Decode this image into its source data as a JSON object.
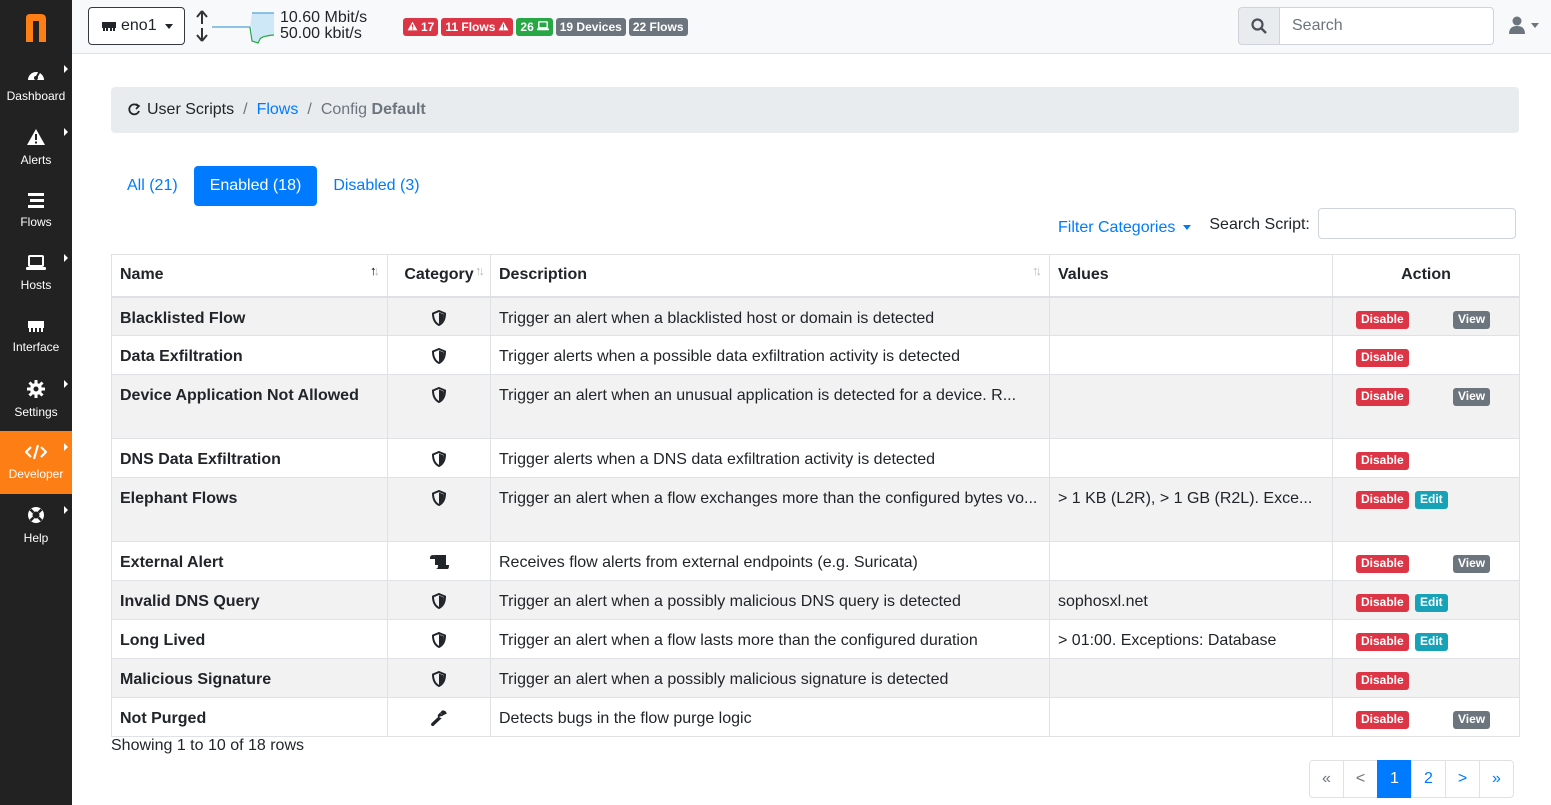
{
  "brand": {
    "logo_letter": "n",
    "logo_color": "#fd7e14"
  },
  "sidebar": {
    "items": [
      {
        "label": "Dashboard",
        "icon": "gauge-icon",
        "caret": true
      },
      {
        "label": "Alerts",
        "icon": "warning-icon",
        "caret": true
      },
      {
        "label": "Flows",
        "icon": "stream-icon",
        "caret": false
      },
      {
        "label": "Hosts",
        "icon": "laptop-icon",
        "caret": true
      },
      {
        "label": "Interface",
        "icon": "ethernet-icon",
        "caret": false
      },
      {
        "label": "Settings",
        "icon": "gear-icon",
        "caret": true
      },
      {
        "label": "Developer",
        "icon": "code-icon",
        "caret": true,
        "active": true
      },
      {
        "label": "Help",
        "icon": "lifebuoy-icon",
        "caret": true
      }
    ]
  },
  "topbar": {
    "interface": "eno1",
    "traffic_up": "10.60 Mbit/s",
    "traffic_down": "50.00 kbit/s",
    "badges": [
      {
        "text": "17",
        "color": "red",
        "icon": "warning-icon"
      },
      {
        "text": "11 Flows",
        "color": "red",
        "icon": "warning-icon"
      },
      {
        "text": "26",
        "color": "green",
        "icon": "laptop-icon"
      },
      {
        "text": "19 Devices",
        "color": "gray"
      },
      {
        "text": "22 Flows",
        "color": "gray"
      }
    ],
    "search_placeholder": "Search"
  },
  "breadcrumb": {
    "root": "User Scripts",
    "link": "Flows",
    "active_prefix": "Config",
    "active_bold": "Default"
  },
  "tabs": [
    {
      "label": "All (21)",
      "active": false
    },
    {
      "label": "Enabled (18)",
      "active": true
    },
    {
      "label": "Disabled (3)",
      "active": false
    }
  ],
  "filters": {
    "categories_label": "Filter Categories",
    "search_label": "Search Script:"
  },
  "table": {
    "headers": {
      "name": "Name",
      "category": "Category",
      "description": "Description",
      "values": "Values",
      "action": "Action"
    },
    "rows": [
      {
        "name": "Blacklisted Flow",
        "category_icon": "shield-icon",
        "description": "Trigger an alert when a blacklisted host or domain is detected",
        "values": "",
        "actions": [
          "Disable",
          "View"
        ]
      },
      {
        "name": "Data Exfiltration",
        "category_icon": "shield-icon",
        "description": "Trigger alerts when a possible data exfiltration activity is detected",
        "values": "",
        "actions": [
          "Disable"
        ]
      },
      {
        "name": "Device Application Not Allowed",
        "category_icon": "shield-icon",
        "description": "Trigger an alert when an unusual application is detected for a device. R...",
        "values": "",
        "actions": [
          "Disable",
          "View"
        ]
      },
      {
        "name": "DNS Data Exfiltration",
        "category_icon": "shield-icon",
        "description": "Trigger alerts when a DNS data exfiltration activity is detected",
        "values": "",
        "actions": [
          "Disable"
        ]
      },
      {
        "name": "Elephant Flows",
        "category_icon": "shield-icon",
        "description": "Trigger an alert when a flow exchanges more than the configured bytes vo...",
        "values": "> 1 KB (L2R), > 1 GB (R2L). Exce...",
        "actions": [
          "Disable",
          "Edit"
        ]
      },
      {
        "name": "External Alert",
        "category_icon": "scroll-icon",
        "description": "Receives flow alerts from external endpoints (e.g. Suricata)",
        "values": "",
        "actions": [
          "Disable",
          "View"
        ]
      },
      {
        "name": "Invalid DNS Query",
        "category_icon": "shield-icon",
        "description": "Trigger an alert when a possibly malicious DNS query is detected",
        "values": "sophosxl.net",
        "actions": [
          "Disable",
          "Edit"
        ]
      },
      {
        "name": "Long Lived",
        "category_icon": "shield-icon",
        "description": "Trigger an alert when a flow lasts more than the configured duration",
        "values": "> 01:00. Exceptions: Database",
        "actions": [
          "Disable",
          "Edit"
        ]
      },
      {
        "name": "Malicious Signature",
        "category_icon": "shield-icon",
        "description": "Trigger an alert when a possibly malicious signature is detected",
        "values": "",
        "actions": [
          "Disable"
        ]
      },
      {
        "name": "Not Purged",
        "category_icon": "wrench-icon",
        "description": "Detects bugs in the flow purge logic",
        "values": "",
        "actions": [
          "Disable",
          "View"
        ]
      }
    ]
  },
  "footer": {
    "showing": "Showing 1 to 10 of 18 rows",
    "pages": [
      "«",
      "<",
      "1",
      "2",
      ">",
      "»"
    ],
    "active_page": "1"
  }
}
